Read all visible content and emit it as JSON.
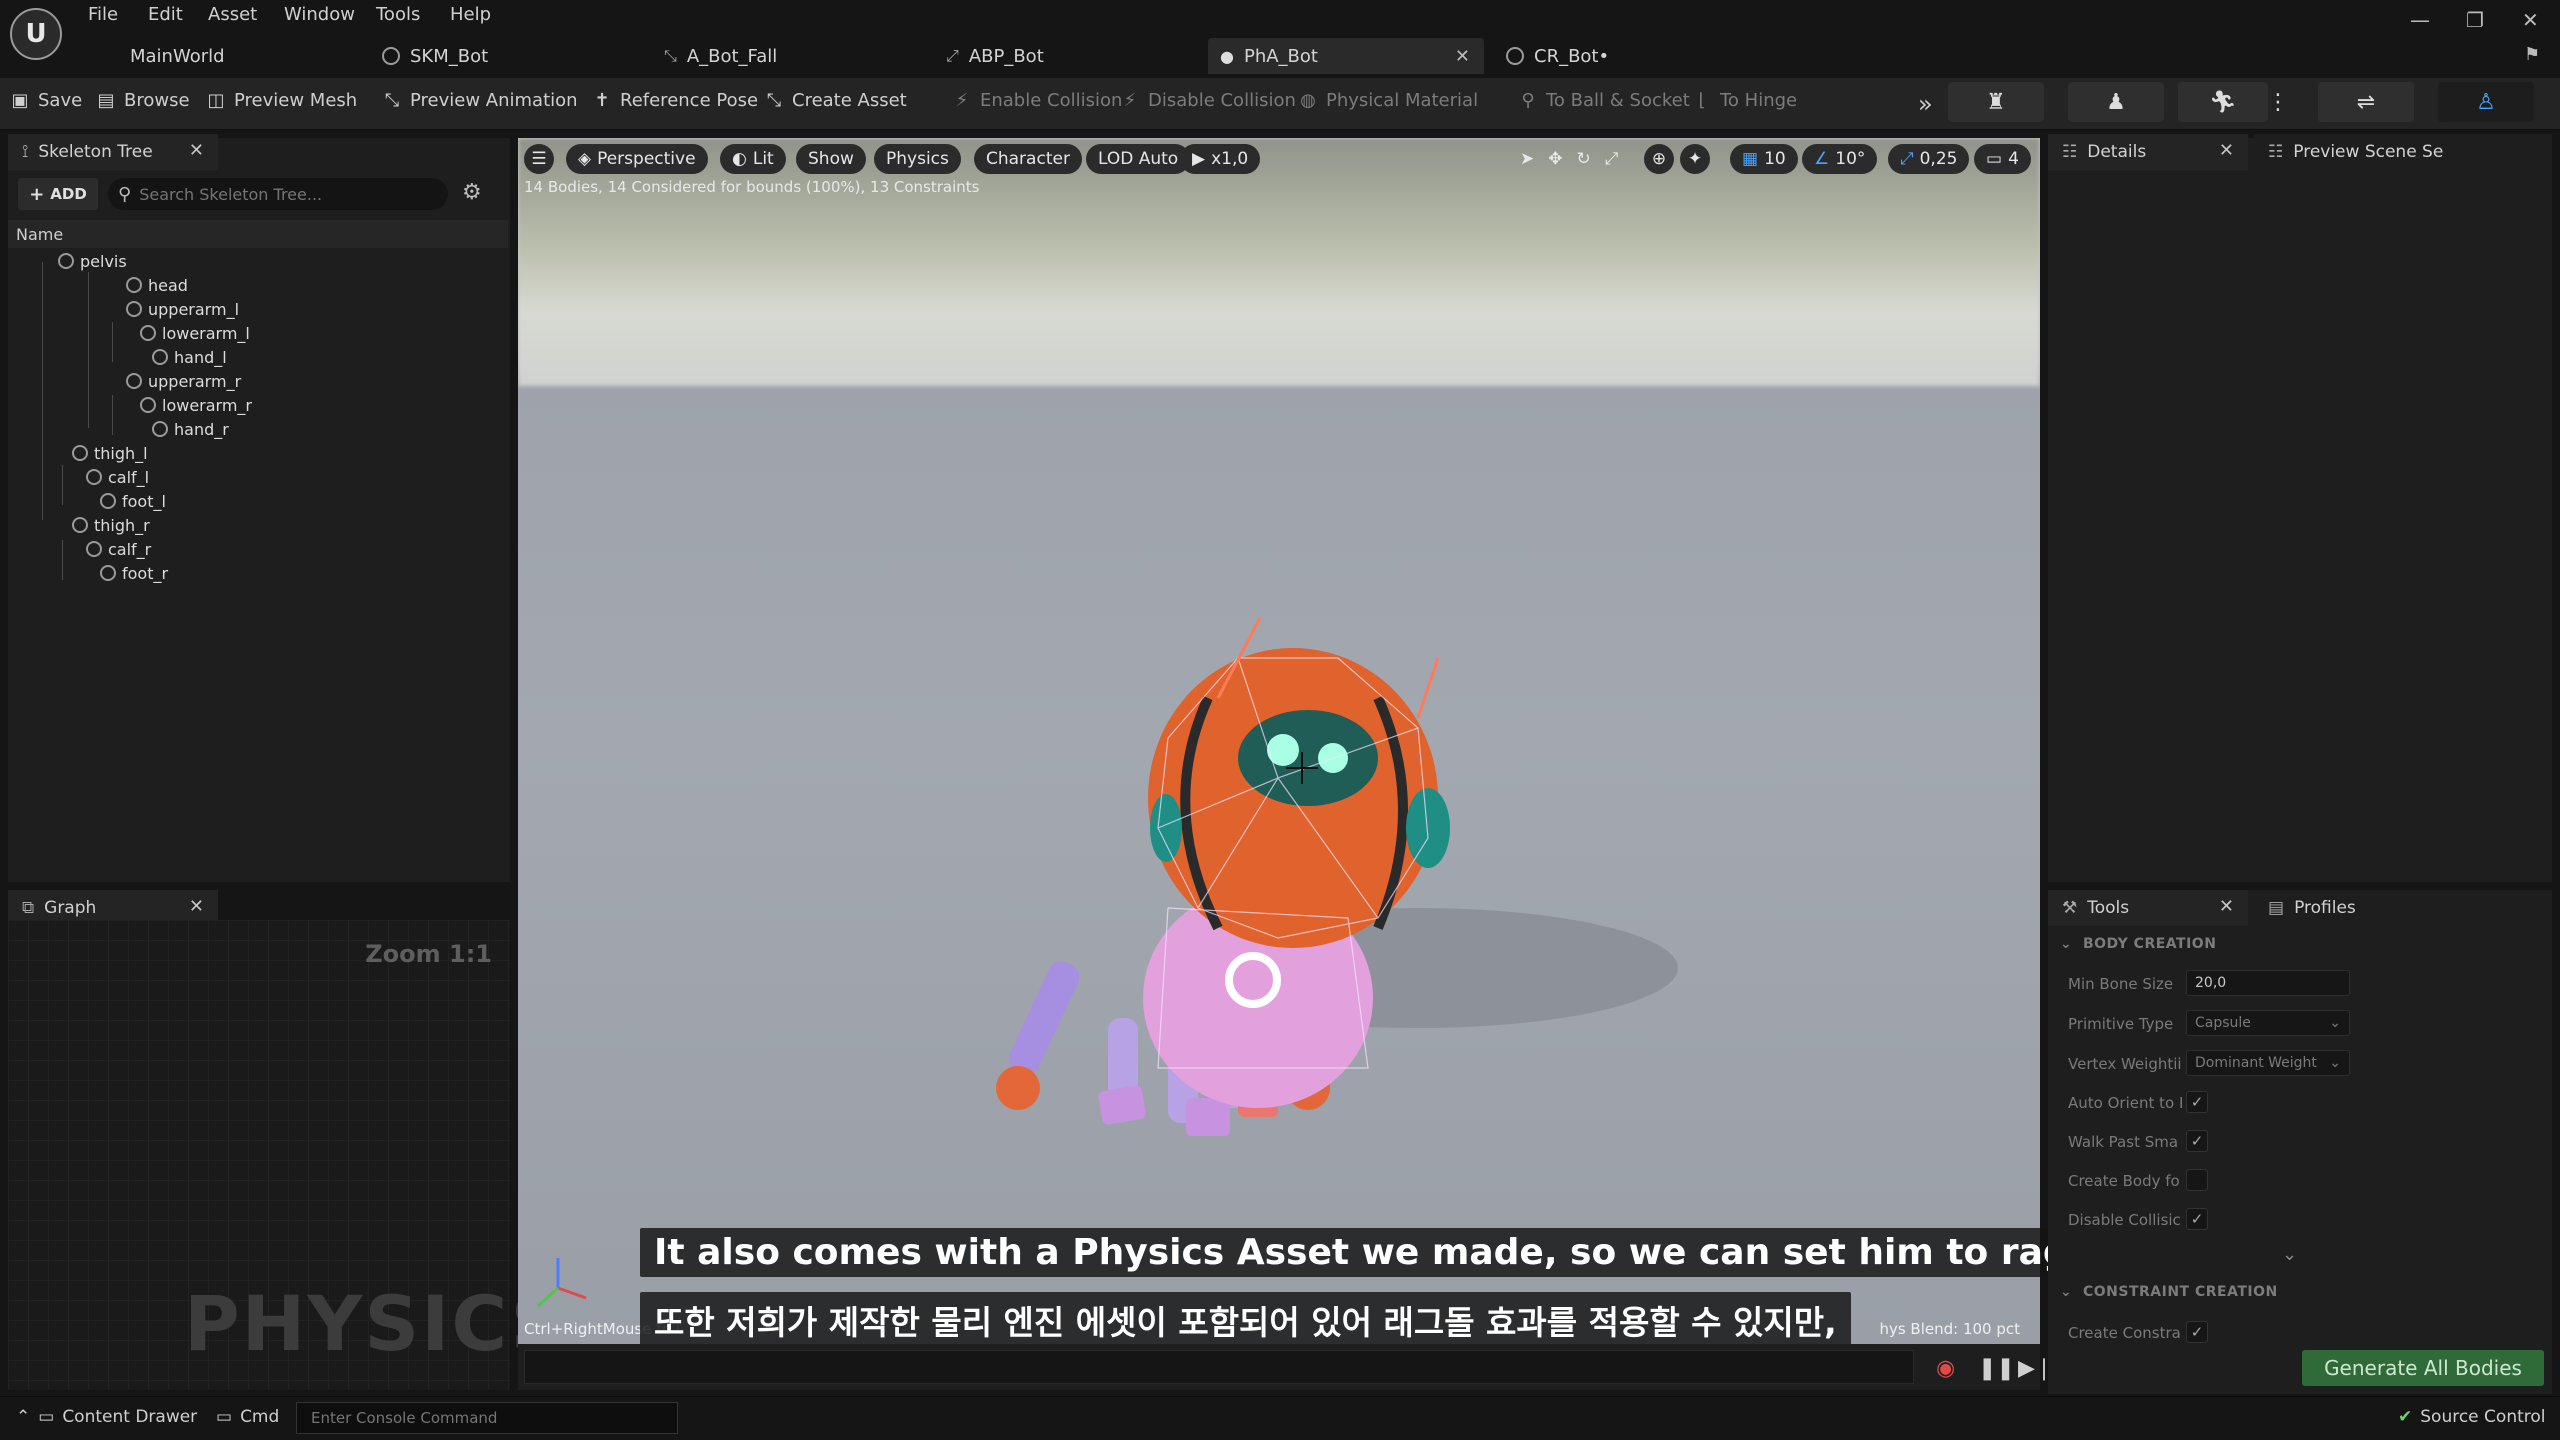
{
  "menu": [
    "File",
    "Edit",
    "Asset",
    "Window",
    "Tools",
    "Help"
  ],
  "level_name": "MainWorld",
  "tabs": [
    {
      "label": "SKM_Bot"
    },
    {
      "label": "A_Bot_Fall"
    },
    {
      "label": "ABP_Bot"
    },
    {
      "label": "PhA_Bot"
    },
    {
      "label": "CR_Bot•"
    }
  ],
  "toolbar": {
    "save": "Save",
    "browse": "Browse",
    "preview_mesh": "Preview Mesh",
    "preview_animation": "Preview Animation",
    "reference_pose": "Reference Pose",
    "create_asset": "Create Asset",
    "enable_collision": "Enable Collision",
    "disable_collision": "Disable Collision",
    "physical_material": "Physical Material",
    "to_ball_socket": "To Ball & Socket",
    "to_hinge": "To Hinge"
  },
  "skeleton_tree": {
    "tab": "Skeleton Tree",
    "add_label": "ADD",
    "search_placeholder": "Search Skeleton Tree...",
    "header": "Name",
    "bones": [
      "pelvis",
      "head",
      "upperarm_l",
      "lowerarm_l",
      "hand_l",
      "upperarm_r",
      "lowerarm_r",
      "hand_r",
      "thigh_l",
      "calf_l",
      "foot_l",
      "thigh_r",
      "calf_r",
      "foot_r"
    ]
  },
  "graph": {
    "tab": "Graph",
    "zoom": "Zoom 1:1",
    "watermark": "PHYSICS"
  },
  "viewport": {
    "perspective": "Perspective",
    "lit": "Lit",
    "show": "Show",
    "physics": "Physics",
    "character": "Character",
    "lod": "LOD Auto",
    "play_speed": "x1,0",
    "grid_snap": "10",
    "rot_snap": "10°",
    "scale_snap": "0,25",
    "camera_speed": "4",
    "stats": "14 Bodies, 14 Considered for bounds (100%), 13 Constraints",
    "hint_left": "Ctrl+RightMouse to i",
    "hint_right": "hys Blend: 100 pct"
  },
  "subtitles": {
    "en": "It also comes with a Physics Asset we made, so we can set him to ragdoll,",
    "ko": "또한 저희가 제작한 물리 엔진 에셋이 포함되어 있어 래그돌 효과를 적용할 수 있지만,"
  },
  "details": {
    "tab": "Details",
    "preview_tab": "Preview Scene Se"
  },
  "tools": {
    "tab": "Tools",
    "profiles_tab": "Profiles",
    "body_creation": "BODY CREATION",
    "min_bone_size_label": "Min Bone Size",
    "min_bone_size_value": "20,0",
    "primitive_type_label": "Primitive Type",
    "primitive_type_value": "Capsule",
    "vertex_weighting_label": "Vertex Weightii",
    "vertex_weighting_value": "Dominant Weight",
    "auto_orient_label": "Auto Orient to I",
    "walk_past_label": "Walk Past Sma",
    "create_body_label": "Create Body fo",
    "disable_collision_label": "Disable Collisic",
    "constraint_creation": "CONSTRAINT CREATION",
    "create_constraints_label": "Create Constra",
    "generate_button": "Generate All Bodies"
  },
  "statusbar": {
    "content_drawer": "Content Drawer",
    "cmd": "Cmd",
    "console_placeholder": "Enter Console Command",
    "source_control": "Source Control"
  },
  "colors": {
    "accent_green": "#2f6b39",
    "panel": "#1e1e1e",
    "robot_orange": "#e0622d",
    "robot_pink": "#d88fd0",
    "robot_teal": "#1f8f86"
  }
}
